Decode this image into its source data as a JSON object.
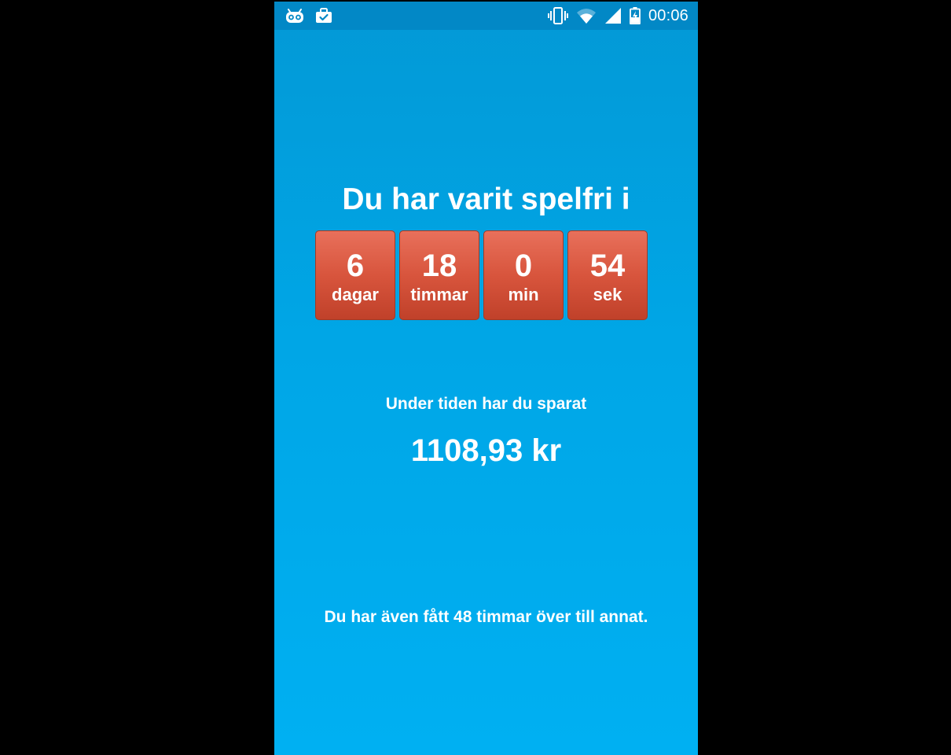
{
  "status_bar": {
    "left_icons": [
      "android-debug-icon",
      "briefcase-check-icon"
    ],
    "right_icons": [
      "vibrate-icon",
      "wifi-icon",
      "signal-icon",
      "battery-charging-icon"
    ],
    "time": "00:06",
    "background": "#0288c6"
  },
  "main": {
    "headline": "Du har varit spelfri i",
    "counters": [
      {
        "value": "6",
        "unit": "dagar"
      },
      {
        "value": "18",
        "unit": "timmar"
      },
      {
        "value": "0",
        "unit": "min"
      },
      {
        "value": "54",
        "unit": "sek"
      }
    ],
    "saved_label": "Under tiden har du sparat",
    "saved_amount": "1108,93 kr",
    "extra_text": "Du har även fått 48 timmar över till annat."
  },
  "colors": {
    "background_top": "#0399d6",
    "background_bottom": "#00b0f2",
    "tile_top": "#e8705b",
    "tile_bottom": "#c0412a",
    "text": "#ffffff"
  }
}
